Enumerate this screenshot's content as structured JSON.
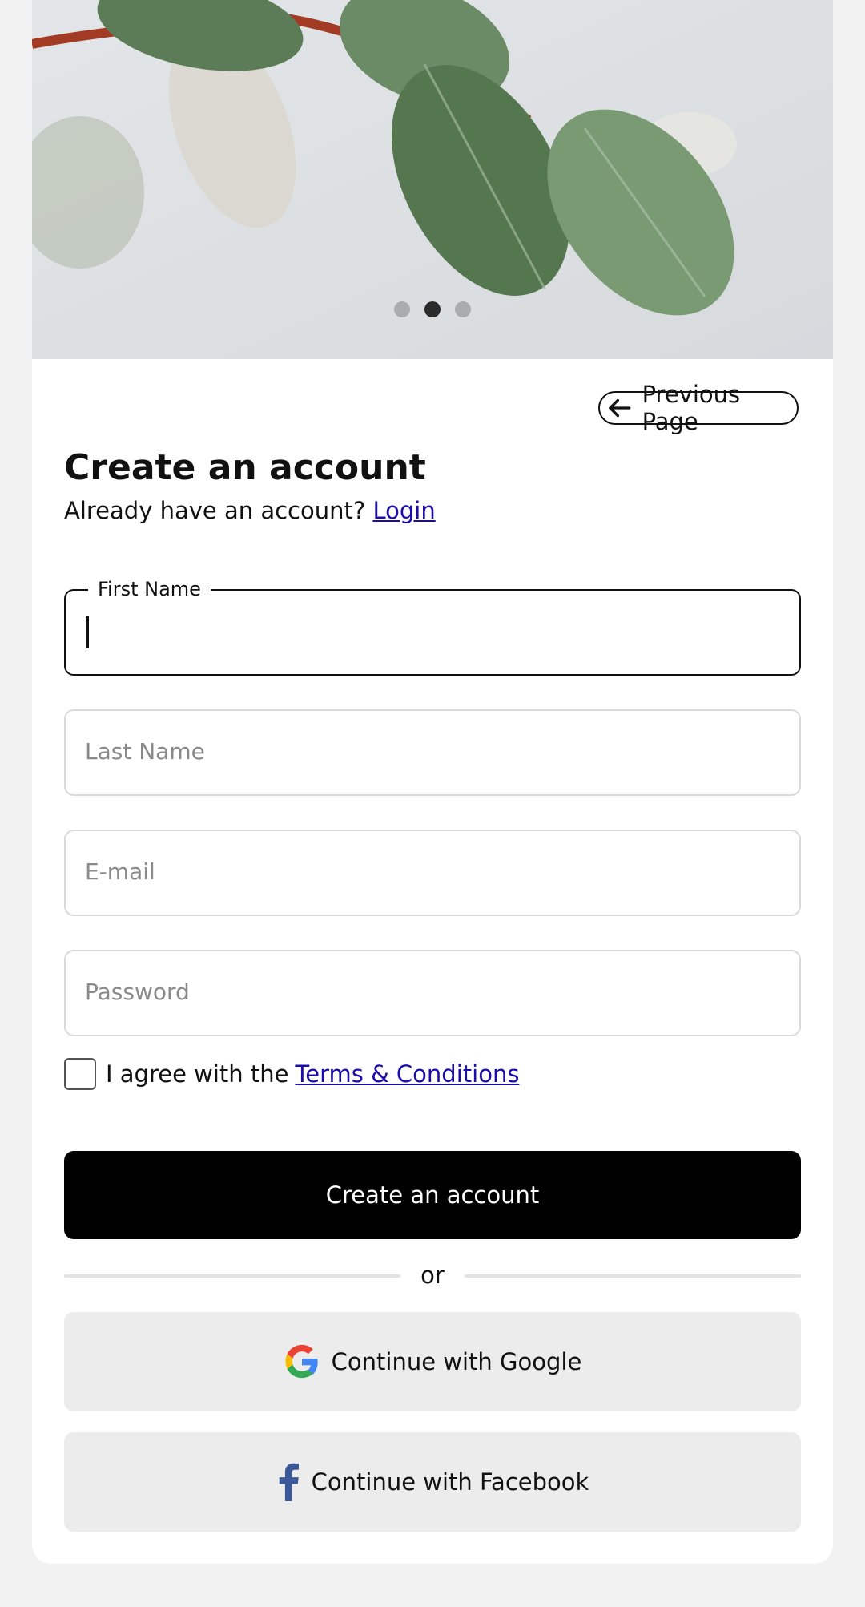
{
  "colors": {
    "primary": "#000000",
    "link": "#1a0dab",
    "background": "#f2f2f2",
    "social_bg": "#ececec",
    "google_red": "#EA4335",
    "google_blue": "#4285F4",
    "google_yellow": "#FBBC05",
    "google_green": "#34A853",
    "facebook": "#3b5998"
  },
  "carousel": {
    "slide_count": 3,
    "active_index": 1
  },
  "nav": {
    "previous_label": "Previous Page",
    "previous_icon": "arrow-left-icon"
  },
  "form": {
    "title": "Create an account",
    "subtitle_text": "Already have an account?",
    "login_link": "Login",
    "first_name_label": "First Name",
    "first_name_value": "",
    "last_name_placeholder": "Last Name",
    "email_placeholder": "E-mail",
    "password_placeholder": "Password",
    "agree_text": "I agree with the",
    "terms_link": "Terms & Conditions",
    "agree_checked": false,
    "submit_label": "Create an account"
  },
  "divider": {
    "label": "or"
  },
  "social": {
    "google_label": "Continue with Google",
    "google_icon": "google-icon",
    "facebook_label": "Continue with Facebook",
    "facebook_icon": "facebook-icon"
  }
}
